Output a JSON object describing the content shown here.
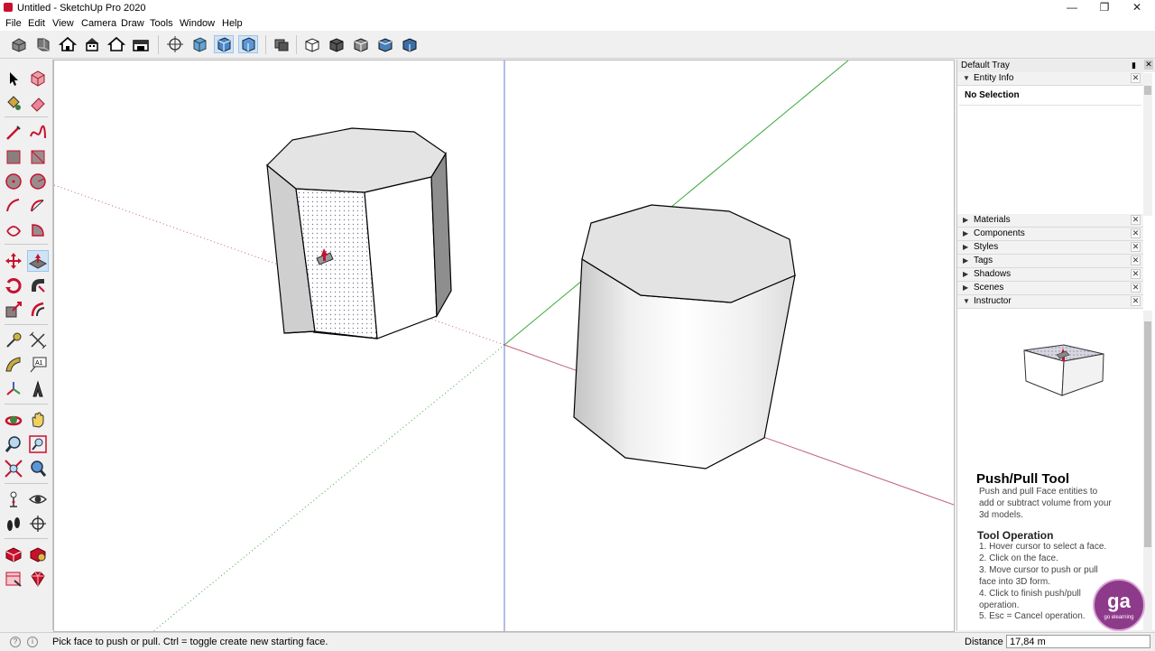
{
  "window": {
    "title": "Untitled - SketchUp Pro 2020",
    "controls": [
      "—",
      "❐",
      "✕"
    ]
  },
  "menu": [
    "File",
    "Edit",
    "View",
    "Camera",
    "Draw",
    "Tools",
    "Window",
    "Help"
  ],
  "toolbar_icons": [
    "views-iso-icon",
    "views-top-icon",
    "views-front-icon",
    "views-right-icon",
    "views-back-icon",
    "views-left-icon",
    "xray-icon",
    "back-edges-icon",
    "wireframe-icon",
    "hidden-line-icon",
    "shaded-icon",
    "shaded-textures-icon",
    "monochrome-icon",
    "solid-outer-shell-icon",
    "solid-intersect-icon",
    "solid-union-icon",
    "solid-subtract-icon",
    "solid-trim-icon"
  ],
  "left_tools": [
    "select-icon",
    "make-component-icon",
    "paint-bucket-icon",
    "eraser-icon",
    "line-icon",
    "freehand-icon",
    "rectangle-icon",
    "rotated-rectangle-icon",
    "circle-icon",
    "polygon-icon",
    "arc-icon",
    "2pt-arc-icon",
    "3pt-arc-icon",
    "pie-icon",
    "move-icon",
    "push-pull-icon",
    "rotate-icon",
    "follow-me-icon",
    "scale-icon",
    "offset-icon",
    "tape-measure-icon",
    "dimension-icon",
    "protractor-icon",
    "text-icon",
    "axes-icon",
    "3d-text-icon",
    "orbit-icon",
    "pan-icon",
    "zoom-icon",
    "zoom-window-icon",
    "zoom-extents-icon",
    "previous-view-icon",
    "position-camera-icon",
    "look-around-icon",
    "walk-icon",
    "section-plane-icon",
    "3d-warehouse-icon",
    "extension-warehouse-icon",
    "layout-icon",
    "ruby-icon"
  ],
  "tray": {
    "title": "Default Tray",
    "entity_info": {
      "label": "Entity Info",
      "content": "No Selection"
    },
    "panels": [
      "Materials",
      "Components",
      "Styles",
      "Tags",
      "Shadows",
      "Scenes",
      "Instructor"
    ],
    "instructor": {
      "title": "Push/Pull Tool",
      "description": "Push and pull Face entities to add or subtract volume from your 3d models.",
      "operation_title": "Tool Operation",
      "steps": [
        "1. Hover cursor to select a face.",
        "2. Click on the face.",
        "3. Move cursor to push or pull face into 3D form.",
        "4. Click to finish push/pull operation.",
        "5. Esc = Cancel operation."
      ]
    }
  },
  "status": {
    "message": "Pick face to push or pull.  Ctrl = toggle create new starting face.",
    "measurement_label": "Distance",
    "measurement_value": "17,84 m"
  },
  "watermark": "go elearning",
  "colors": {
    "accent_red": "#c8102e",
    "active_tool": "#cfe3f7",
    "axis_red": "#c0607a",
    "axis_green": "#4caf50",
    "axis_blue": "#6a78d1",
    "watermark": "#8e3a8a"
  }
}
